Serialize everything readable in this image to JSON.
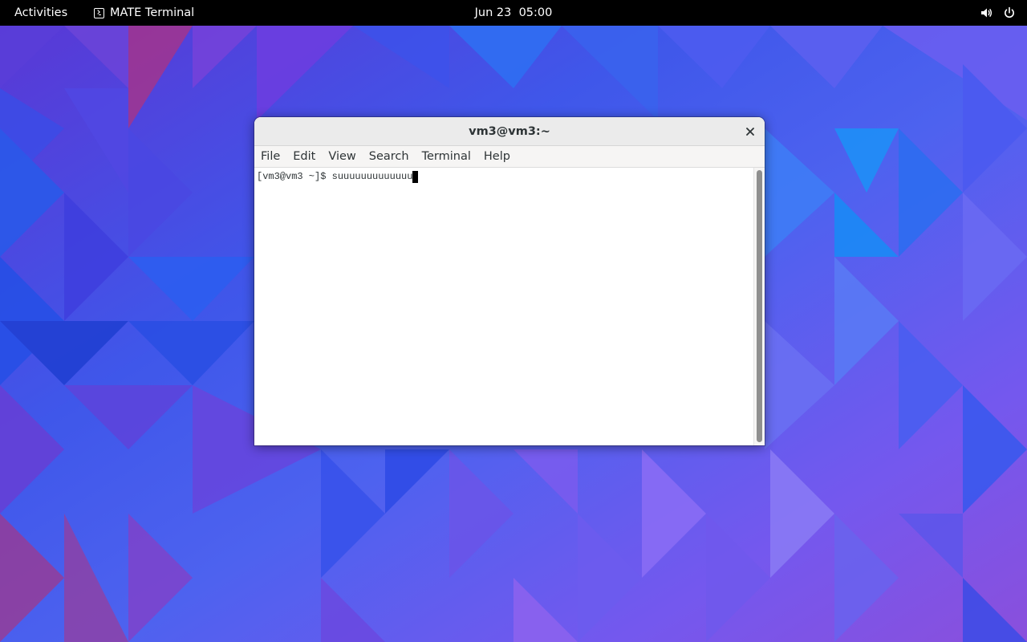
{
  "topbar": {
    "activities_label": "Activities",
    "app_name": "MATE Terminal",
    "clock_date": "Jun 23",
    "clock_time": "05:00",
    "tray_icons": [
      "volume-icon",
      "power-icon"
    ]
  },
  "window": {
    "title": "vm3@vm3:~",
    "close_icon": "close-icon",
    "menu": [
      "File",
      "Edit",
      "View",
      "Search",
      "Terminal",
      "Help"
    ]
  },
  "terminal": {
    "prompt": "[vm3@vm3 ~]$ ",
    "input": "suuuuuuuuuuuuu"
  },
  "colors": {
    "topbar_bg": "#000000",
    "titlebar_bg": "#ebebeb",
    "menubar_bg": "#f6f5f4",
    "terminal_bg": "#ffffff",
    "terminal_fg": "#2e3436"
  }
}
